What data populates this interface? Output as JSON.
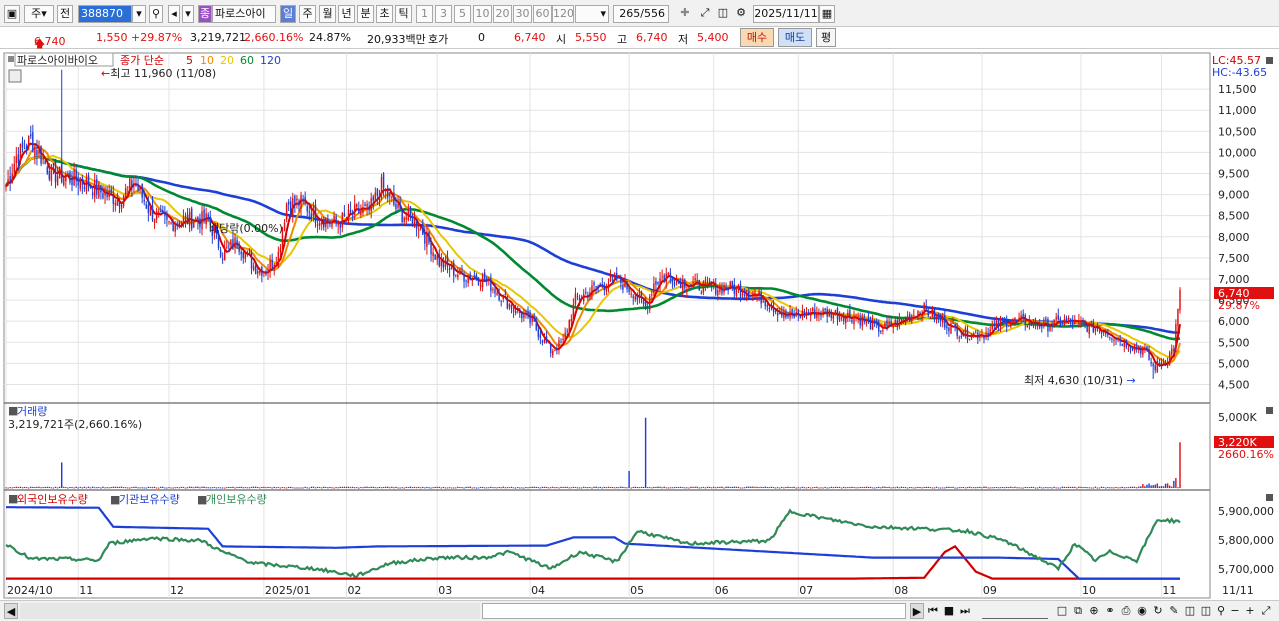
{
  "toolbar": {
    "period_label": "주",
    "prev_label": "전",
    "code": "388870",
    "name_badge": "종",
    "stock_name": "파로스아이",
    "intervals": [
      "일",
      "주",
      "월",
      "년",
      "분",
      "초",
      "틱"
    ],
    "minute_options": [
      "1",
      "3",
      "5",
      "10",
      "20",
      "30",
      "60",
      "120"
    ],
    "count_value": "265",
    "count_total": "/556",
    "date": "2025/11/11",
    "icons": [
      "menu-icon",
      "arrow-down-icon",
      "speaker-icon",
      "sound-down-icon",
      "crosshair-icon",
      "expand-icon",
      "save-icon",
      "gear-icon",
      "calendar-icon"
    ]
  },
  "quote": {
    "price": "6,740",
    "change": "1,550",
    "change_pct": "+29.87%",
    "volume": "3,219,721",
    "vol_ratio": "2,660.16%",
    "turnover": "24.87%",
    "amount": "20,933백만",
    "hoga_label": "호가",
    "hoga_value": "0",
    "cur2": "6,740",
    "open_label": "시",
    "open": "5,550",
    "high_label": "고",
    "high": "6,740",
    "low_label": "저",
    "low": "5,400",
    "buy_label": "매수",
    "sell_label": "매도",
    "avg_label": "평"
  },
  "legend": {
    "stock": "파로스아이바이오",
    "ma_label": "종가 단순",
    "periods": [
      "5",
      "10",
      "20",
      "60",
      "120"
    ],
    "period_colors": [
      "#d00000",
      "#f08a00",
      "#e6c800",
      "#008a30",
      "#1e3fd6"
    ],
    "max_label": "최고 11,960 (11/08)",
    "min_label": "최저 4,630 (10/31)",
    "dividend_label": "배당락(0.00%)",
    "lc": "LC:45.57",
    "hc": "HC:-43.65"
  },
  "volume_panel": {
    "title": "거래량",
    "value_label": "3,219,721주(2,660.16%)",
    "top_tick": "5,000K",
    "last_tag": "3,220K",
    "last_pct": "2660.16%"
  },
  "holdings_panel": {
    "labels": [
      "외국인보유수량",
      "기관보유수량",
      "개인보유수량"
    ],
    "label_colors": [
      "#d00000",
      "#1e3fd6",
      "#2f8a57"
    ],
    "ticks": [
      "5,900,000",
      "5,800,000",
      "5,700,000"
    ]
  },
  "price_tag": {
    "value": "6,740",
    "pct": "29.87%"
  },
  "x_axis_labels": [
    "2024/10",
    "11",
    "12",
    "2025/01",
    "02",
    "03",
    "04",
    "05",
    "06",
    "07",
    "08",
    "09",
    "10",
    "11",
    "11/11"
  ],
  "chart_data": {
    "type": "candlestick",
    "y_ticks": [
      11500,
      11000,
      10500,
      10000,
      9500,
      9000,
      8500,
      8000,
      7500,
      7000,
      6500,
      6000,
      5500,
      5000,
      4500
    ],
    "ylim": [
      4250,
      12000
    ],
    "max": {
      "value": 11960,
      "date": "11/08"
    },
    "min": {
      "value": 4630,
      "date": "10/31"
    },
    "last_close": 6740,
    "anchors_close": [
      [
        0,
        9200
      ],
      [
        5,
        9900
      ],
      [
        12,
        10300
      ],
      [
        22,
        9500
      ],
      [
        38,
        9300
      ],
      [
        48,
        9000
      ],
      [
        55,
        8900
      ],
      [
        62,
        9300
      ],
      [
        70,
        8600
      ],
      [
        78,
        8300
      ],
      [
        88,
        8400
      ],
      [
        98,
        8400
      ],
      [
        105,
        7600
      ],
      [
        112,
        7900
      ],
      [
        120,
        7300
      ],
      [
        126,
        7200
      ],
      [
        132,
        7600
      ],
      [
        136,
        8800
      ],
      [
        144,
        8800
      ],
      [
        150,
        8500
      ],
      [
        160,
        8300
      ],
      [
        170,
        8600
      ],
      [
        176,
        8600
      ],
      [
        182,
        9200
      ],
      [
        190,
        8600
      ],
      [
        200,
        8300
      ],
      [
        210,
        7400
      ],
      [
        220,
        7100
      ],
      [
        232,
        7000
      ],
      [
        244,
        6400
      ],
      [
        256,
        5900
      ],
      [
        264,
        5300
      ],
      [
        270,
        5500
      ],
      [
        276,
        6500
      ],
      [
        286,
        6800
      ],
      [
        296,
        7000
      ],
      [
        304,
        6700
      ],
      [
        310,
        6300
      ],
      [
        314,
        6900
      ],
      [
        320,
        7100
      ],
      [
        330,
        6900
      ],
      [
        340,
        6800
      ],
      [
        350,
        6800
      ],
      [
        360,
        6700
      ],
      [
        368,
        6500
      ],
      [
        378,
        6100
      ],
      [
        390,
        6200
      ],
      [
        400,
        6200
      ],
      [
        412,
        6100
      ],
      [
        424,
        5800
      ],
      [
        434,
        6000
      ],
      [
        444,
        6300
      ],
      [
        454,
        6000
      ],
      [
        464,
        5700
      ],
      [
        474,
        5700
      ],
      [
        484,
        6000
      ],
      [
        494,
        6000
      ],
      [
        504,
        5900
      ],
      [
        514,
        6000
      ],
      [
        522,
        5900
      ],
      [
        532,
        5800
      ],
      [
        542,
        5500
      ],
      [
        552,
        5300
      ],
      [
        556,
        4900
      ],
      [
        562,
        5050
      ],
      [
        566,
        5400
      ],
      [
        569,
        6740
      ]
    ],
    "volume_K": {
      "max_tick": 5000,
      "last": 3220
    },
    "holdings_ylim": [
      5660000,
      5960000
    ],
    "foreign_anchors": [
      [
        0,
        5665000
      ],
      [
        410,
        5665000
      ],
      [
        445,
        5668000
      ],
      [
        455,
        5760000
      ],
      [
        460,
        5780000
      ],
      [
        470,
        5690000
      ],
      [
        478,
        5665000
      ],
      [
        569,
        5665000
      ]
    ],
    "institution_anchors": [
      [
        0,
        5920000
      ],
      [
        45,
        5918000
      ],
      [
        52,
        5850000
      ],
      [
        98,
        5843000
      ],
      [
        105,
        5780000
      ],
      [
        160,
        5775000
      ],
      [
        180,
        5780000
      ],
      [
        262,
        5783000
      ],
      [
        275,
        5812000
      ],
      [
        295,
        5812000
      ],
      [
        300,
        5790000
      ],
      [
        420,
        5740000
      ],
      [
        480,
        5740000
      ],
      [
        510,
        5735000
      ],
      [
        520,
        5665000
      ],
      [
        569,
        5665000
      ]
    ],
    "individual_anchors": [
      [
        0,
        5790000
      ],
      [
        12,
        5735000
      ],
      [
        30,
        5735000
      ],
      [
        45,
        5730000
      ],
      [
        50,
        5790000
      ],
      [
        70,
        5810000
      ],
      [
        95,
        5800000
      ],
      [
        105,
        5760000
      ],
      [
        120,
        5720000
      ],
      [
        150,
        5700000
      ],
      [
        170,
        5675000
      ],
      [
        186,
        5720000
      ],
      [
        210,
        5740000
      ],
      [
        232,
        5740000
      ],
      [
        244,
        5760000
      ],
      [
        256,
        5725000
      ],
      [
        264,
        5700000
      ],
      [
        278,
        5760000
      ],
      [
        296,
        5725000
      ],
      [
        306,
        5835000
      ],
      [
        330,
        5790000
      ],
      [
        350,
        5795000
      ],
      [
        370,
        5800000
      ],
      [
        380,
        5905000
      ],
      [
        400,
        5875000
      ],
      [
        420,
        5850000
      ],
      [
        440,
        5845000
      ],
      [
        466,
        5835000
      ],
      [
        484,
        5800000
      ],
      [
        500,
        5740000
      ],
      [
        510,
        5700000
      ],
      [
        518,
        5790000
      ],
      [
        528,
        5730000
      ],
      [
        535,
        5760000
      ],
      [
        548,
        5730000
      ],
      [
        558,
        5875000
      ],
      [
        569,
        5870000
      ]
    ]
  }
}
